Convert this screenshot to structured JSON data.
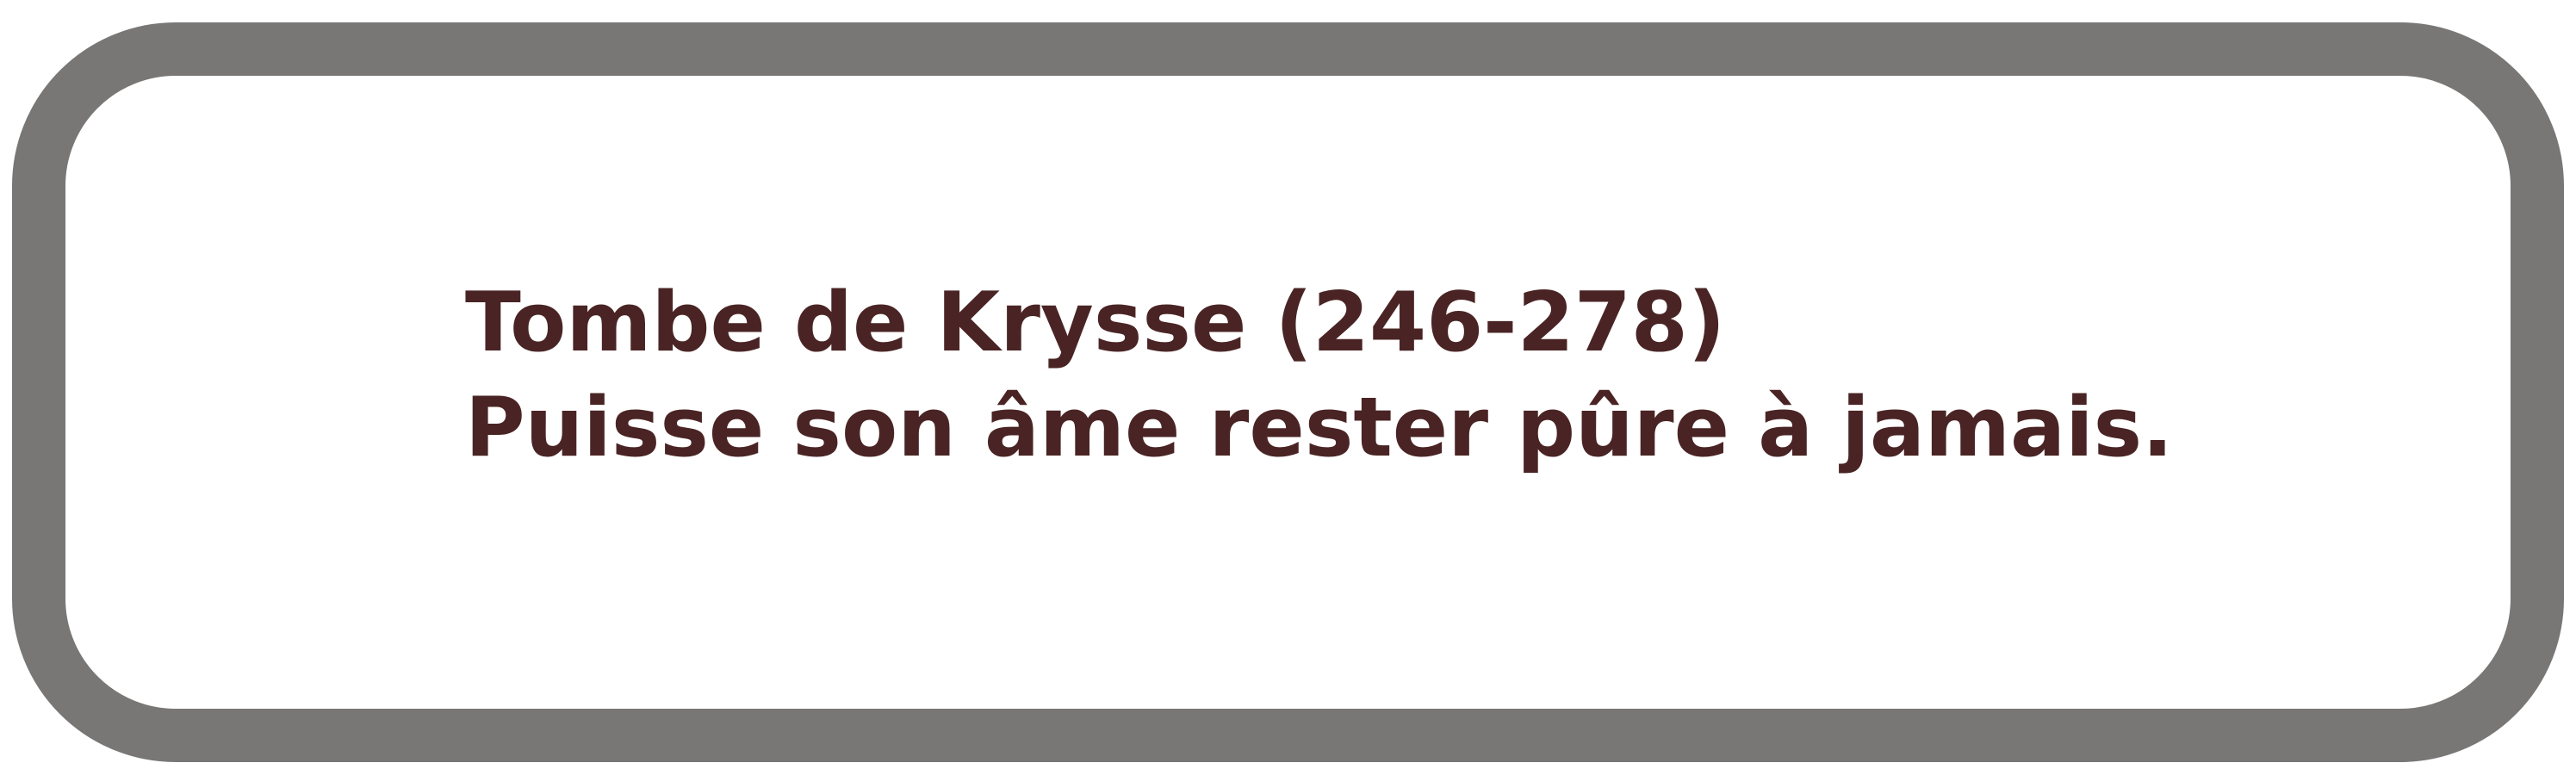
{
  "inscription": {
    "line1": "Tombe de Krysse (246-278)",
    "line2": "Puisse son âme rester pûre à jamais."
  },
  "colors": {
    "border": "#797776",
    "text": "#4a2424",
    "background": "#ffffff"
  }
}
